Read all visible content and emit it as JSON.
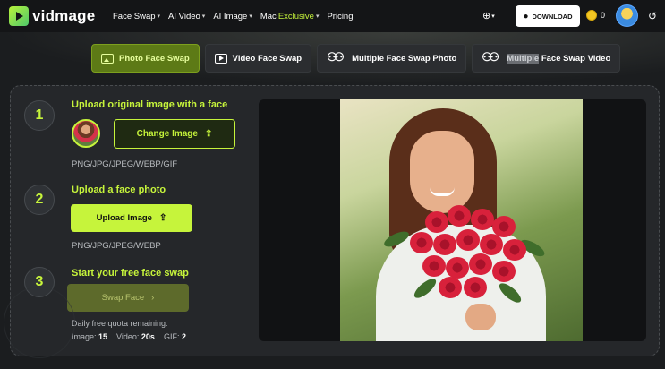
{
  "header": {
    "brand": "vidmage",
    "nav": [
      {
        "label": "Face Swap",
        "has_dropdown": true
      },
      {
        "label": "AI Video",
        "has_dropdown": true
      },
      {
        "label": "AI Image",
        "has_dropdown": true
      },
      {
        "label_prefix": "Mac ",
        "label_accent": "Exclusive",
        "has_dropdown": true
      },
      {
        "label": "Pricing",
        "has_dropdown": false
      }
    ],
    "download_label": "DOWNLOAD",
    "coin_count": "0"
  },
  "tabs": [
    {
      "label": "Photo Face Swap",
      "icon": "image-icon",
      "active": true
    },
    {
      "label": "Video Face Swap",
      "icon": "video-icon",
      "active": false
    },
    {
      "label": "Multiple Face Swap Photo",
      "icon": "people-icon",
      "active": false
    },
    {
      "label_highlight": "Multiple",
      "label_rest": " Face Swap Video",
      "icon": "people-icon",
      "active": false
    }
  ],
  "steps": [
    {
      "number": "1",
      "title": "Upload original image with a face",
      "button": "Change Image",
      "formats": "PNG/JPG/JPEG/WEBP/GIF"
    },
    {
      "number": "2",
      "title": "Upload a face photo",
      "button": "Upload Image",
      "formats": "PNG/JPG/JPEG/WEBP"
    },
    {
      "number": "3",
      "title": "Start your free face swap",
      "button": "Swap Face"
    }
  ],
  "quota": {
    "label": "Daily free quota remaining:",
    "image_label": "Image:",
    "image_value": "15",
    "video_label": "Video:",
    "video_value": "20s",
    "gif_label": "GIF:",
    "gif_value": "2"
  },
  "colors": {
    "accent": "#c6f43b",
    "background": "#1b1d1f",
    "panel": "#25272a"
  }
}
